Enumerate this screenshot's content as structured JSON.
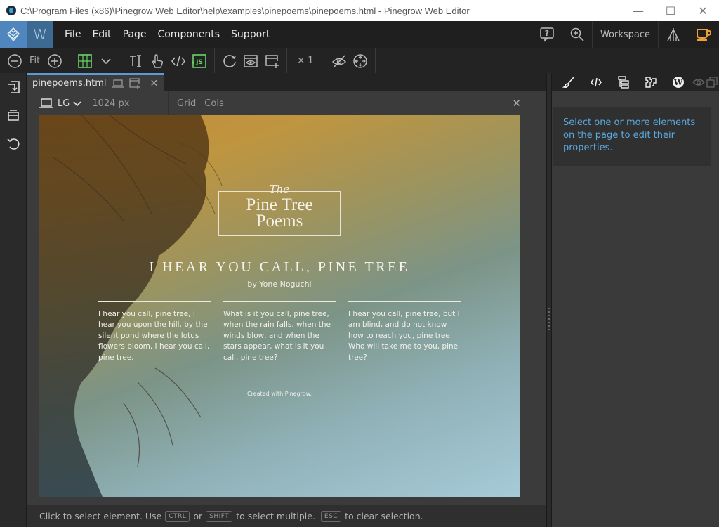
{
  "window": {
    "title": "C:\\Program Files (x86)\\Pinegrow Web Editor\\help\\examples\\pinepoems\\pinepoems.html - Pinegrow Web Editor",
    "controls": {
      "minimize": "—",
      "maximize": "☐",
      "close": "✕"
    }
  },
  "menubar": {
    "logo_w": "W",
    "items": [
      "File",
      "Edit",
      "Page",
      "Components",
      "Support"
    ],
    "right": {
      "help_icon": "help-bubble-icon",
      "zoom_icon": "zoom-in-icon",
      "workspace_label": "Workspace",
      "tree_icon": "pine-tree-icon",
      "coffee_icon": "coffee-cup-icon"
    }
  },
  "toolbar": {
    "zoom_out": "zoom-out-icon",
    "fit_label": "Fit",
    "zoom_in": "zoom-in-icon",
    "multiplier_label": "× 1",
    "accent_color": "#6ad36a"
  },
  "left_rail": {
    "icons": [
      "import-icon",
      "inbox-icon",
      "undo-icon"
    ]
  },
  "editor": {
    "tab": {
      "label": "pinepoems.html"
    },
    "device": {
      "label": "LG",
      "width_label": "1024 px"
    },
    "view_options": [
      "Grid",
      "Cols"
    ]
  },
  "page": {
    "hero_the": "The",
    "hero_title_line1": "Pine Tree",
    "hero_title_line2": "Poems",
    "poem_title": "I HEAR YOU CALL, PINE TREE",
    "poem_author": "by Yone Noguchi",
    "stanzas": [
      "I hear you call, pine tree, I hear you upon the hill, by the silent pond where the lotus flowers bloom, I hear you call, pine tree.",
      "What is it you call, pine tree, when the rain falls, when the winds blow, and when the stars appear, what is it you call, pine tree?",
      "I hear you call, pine tree, but I am blind, and do not know how to reach you, pine tree. Who will take me to you, pine tree?"
    ],
    "footer": "Created with Pinegrow."
  },
  "statusbar": {
    "part1": "Click to select element. Use",
    "key_ctrl": "CTRL",
    "part2": "or",
    "key_shift": "SHIFT",
    "part3": "to select multiple.",
    "key_esc": "ESC",
    "part4": "to clear selection."
  },
  "right_panel": {
    "message": "Select one or more elements on the page to edit their properties.",
    "message_color": "#5aa9e0"
  }
}
